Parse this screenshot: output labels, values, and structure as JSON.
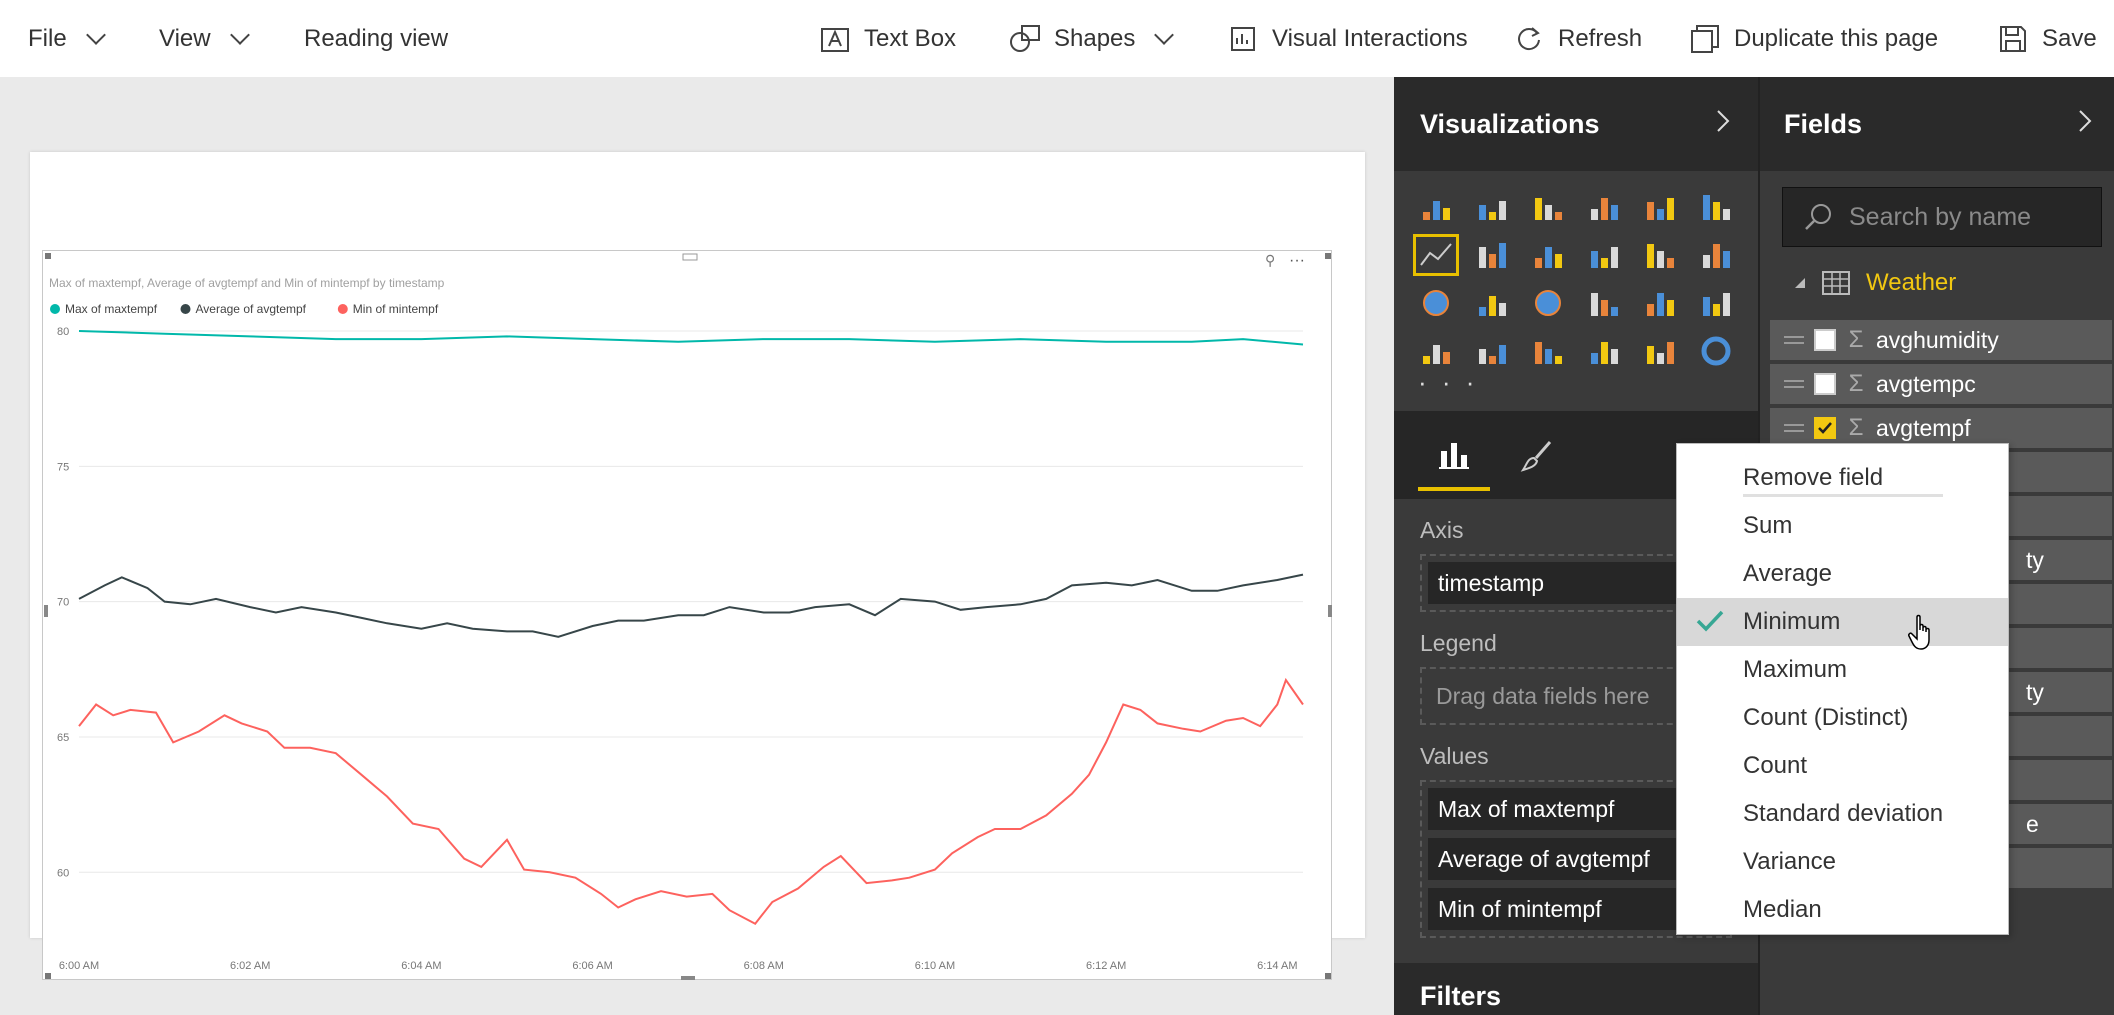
{
  "toolbar": {
    "file": "File",
    "view": "View",
    "reading_view": "Reading view",
    "text_box": "Text Box",
    "shapes": "Shapes",
    "visual_interactions": "Visual Interactions",
    "refresh": "Refresh",
    "duplicate": "Duplicate this page",
    "save": "Save"
  },
  "visualizations": {
    "title": "Visualizations",
    "more": "· · ·",
    "wells": {
      "axis_label": "Axis",
      "axis_field": "timestamp",
      "legend_label": "Legend",
      "legend_placeholder": "Drag data fields here",
      "values_label": "Values",
      "values": [
        "Max of maxtempf",
        "Average of avgtempf",
        "Min of mintempf"
      ]
    },
    "filters_title": "Filters"
  },
  "fields": {
    "title": "Fields",
    "search_placeholder": "Search by name",
    "table_name": "Weather",
    "items": [
      {
        "name": "avghumidity",
        "checked": false
      },
      {
        "name": "avgtempc",
        "checked": false
      },
      {
        "name": "avgtempf",
        "checked": true
      }
    ],
    "partial_suffixes": [
      "ty",
      "ty",
      "e"
    ]
  },
  "context_menu": {
    "items": [
      "Remove field",
      "Sum",
      "Average",
      "Minimum",
      "Maximum",
      "Count (Distinct)",
      "Count",
      "Standard deviation",
      "Variance",
      "Median"
    ],
    "selected": "Minimum"
  },
  "chart_data": {
    "type": "line",
    "title": "Max of maxtempf, Average of avgtempf and Min of mintempf by timestamp",
    "x_tick_labels": [
      "6:00 AM",
      "6:02 AM",
      "6:04 AM",
      "6:06 AM",
      "6:08 AM",
      "6:10 AM",
      "6:12 AM",
      "6:14 AM"
    ],
    "x_range_minutes": [
      0,
      14.3
    ],
    "ylim": [
      56.5,
      80
    ],
    "y_ticks": [
      60,
      65,
      70,
      75,
      80
    ],
    "grid": true,
    "legend_position": "top-left",
    "series": [
      {
        "name": "Max of maxtempf",
        "color": "#01b8aa",
        "points": [
          [
            0,
            80.0
          ],
          [
            1,
            79.9
          ],
          [
            2,
            79.8
          ],
          [
            3,
            79.7
          ],
          [
            4,
            79.7
          ],
          [
            5,
            79.8
          ],
          [
            6,
            79.7
          ],
          [
            7,
            79.6
          ],
          [
            8,
            79.7
          ],
          [
            9,
            79.7
          ],
          [
            10,
            79.6
          ],
          [
            11,
            79.7
          ],
          [
            12,
            79.6
          ],
          [
            13,
            79.6
          ],
          [
            13.6,
            79.7
          ],
          [
            14.3,
            79.5
          ]
        ]
      },
      {
        "name": "Average of avgtempf",
        "color": "#374649",
        "points": [
          [
            0,
            70.1
          ],
          [
            0.3,
            70.6
          ],
          [
            0.5,
            70.9
          ],
          [
            0.8,
            70.5
          ],
          [
            1,
            70.0
          ],
          [
            1.3,
            69.9
          ],
          [
            1.6,
            70.1
          ],
          [
            2,
            69.8
          ],
          [
            2.3,
            69.6
          ],
          [
            2.6,
            69.8
          ],
          [
            3,
            69.6
          ],
          [
            3.3,
            69.4
          ],
          [
            3.6,
            69.2
          ],
          [
            4,
            69.0
          ],
          [
            4.3,
            69.2
          ],
          [
            4.6,
            69.0
          ],
          [
            5,
            68.9
          ],
          [
            5.3,
            68.9
          ],
          [
            5.6,
            68.7
          ],
          [
            6,
            69.1
          ],
          [
            6.3,
            69.3
          ],
          [
            6.6,
            69.3
          ],
          [
            7,
            69.5
          ],
          [
            7.3,
            69.5
          ],
          [
            7.6,
            69.8
          ],
          [
            8,
            69.6
          ],
          [
            8.3,
            69.6
          ],
          [
            8.6,
            69.8
          ],
          [
            9,
            69.9
          ],
          [
            9.3,
            69.5
          ],
          [
            9.6,
            70.1
          ],
          [
            10,
            70.0
          ],
          [
            10.3,
            69.7
          ],
          [
            10.6,
            69.8
          ],
          [
            11,
            69.9
          ],
          [
            11.3,
            70.1
          ],
          [
            11.6,
            70.6
          ],
          [
            12,
            70.7
          ],
          [
            12.3,
            70.6
          ],
          [
            12.6,
            70.8
          ],
          [
            13,
            70.4
          ],
          [
            13.3,
            70.4
          ],
          [
            13.6,
            70.6
          ],
          [
            14,
            70.8
          ],
          [
            14.3,
            71.0
          ]
        ]
      },
      {
        "name": "Min of mintempf",
        "color": "#fd625e",
        "points": [
          [
            0,
            65.4
          ],
          [
            0.2,
            66.2
          ],
          [
            0.4,
            65.8
          ],
          [
            0.6,
            66.0
          ],
          [
            0.9,
            65.9
          ],
          [
            1.1,
            64.8
          ],
          [
            1.4,
            65.2
          ],
          [
            1.7,
            65.8
          ],
          [
            1.9,
            65.5
          ],
          [
            2.2,
            65.2
          ],
          [
            2.4,
            64.6
          ],
          [
            2.7,
            64.6
          ],
          [
            3,
            64.4
          ],
          [
            3.3,
            63.6
          ],
          [
            3.6,
            62.8
          ],
          [
            3.9,
            61.8
          ],
          [
            4.2,
            61.6
          ],
          [
            4.5,
            60.5
          ],
          [
            4.7,
            60.2
          ],
          [
            5,
            61.2
          ],
          [
            5.2,
            60.1
          ],
          [
            5.5,
            60.0
          ],
          [
            5.8,
            59.8
          ],
          [
            6.1,
            59.2
          ],
          [
            6.3,
            58.7
          ],
          [
            6.5,
            59.0
          ],
          [
            6.8,
            59.3
          ],
          [
            7.1,
            59.1
          ],
          [
            7.4,
            59.2
          ],
          [
            7.6,
            58.6
          ],
          [
            7.9,
            58.1
          ],
          [
            8.1,
            58.9
          ],
          [
            8.4,
            59.4
          ],
          [
            8.7,
            60.2
          ],
          [
            8.9,
            60.6
          ],
          [
            9.2,
            59.6
          ],
          [
            9.5,
            59.7
          ],
          [
            9.7,
            59.8
          ],
          [
            10,
            60.1
          ],
          [
            10.2,
            60.7
          ],
          [
            10.5,
            61.3
          ],
          [
            10.7,
            61.6
          ],
          [
            11,
            61.6
          ],
          [
            11.3,
            62.1
          ],
          [
            11.6,
            62.9
          ],
          [
            11.8,
            63.6
          ],
          [
            12,
            64.8
          ],
          [
            12.2,
            66.2
          ],
          [
            12.4,
            66.0
          ],
          [
            12.6,
            65.5
          ],
          [
            12.9,
            65.3
          ],
          [
            13.1,
            65.2
          ],
          [
            13.4,
            65.6
          ],
          [
            13.6,
            65.7
          ],
          [
            13.8,
            65.4
          ],
          [
            14.0,
            66.2
          ],
          [
            14.1,
            67.1
          ],
          [
            14.3,
            66.2
          ]
        ]
      }
    ]
  }
}
